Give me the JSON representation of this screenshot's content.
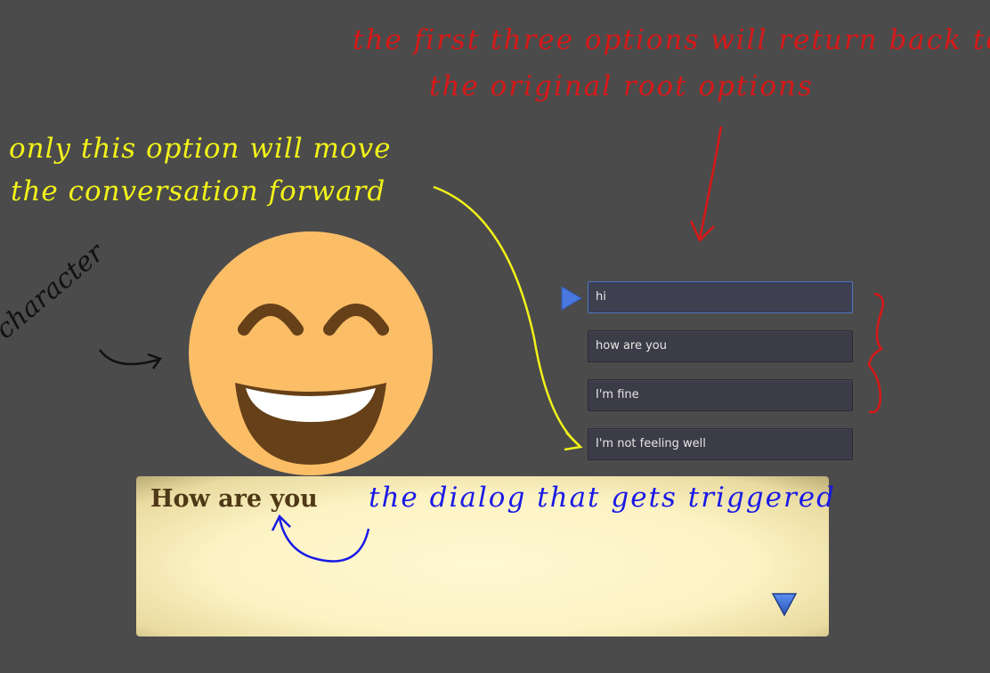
{
  "annotations": {
    "options_note_line1": "the first three options will return back to",
    "options_note_line2": "the original root options",
    "forward_note_line1": "only this option will move",
    "forward_note_line2": "the conversation forward",
    "character_label": "character",
    "dialog_note": "the dialog that gets triggered"
  },
  "options": [
    {
      "label": "hi",
      "selected": true
    },
    {
      "label": "how are you"
    },
    {
      "label": "I'm fine"
    },
    {
      "label": "I'm not feeling well"
    }
  ],
  "dialog": {
    "text": "How are you"
  },
  "colors": {
    "background": "#4b4b4b",
    "face": "#fbbe67",
    "face_features": "#664018",
    "cursor": "#4a78e0",
    "red_note": "#d81818",
    "yellow_note": "#f2f21a",
    "blue_note": "#1a1ae6"
  }
}
